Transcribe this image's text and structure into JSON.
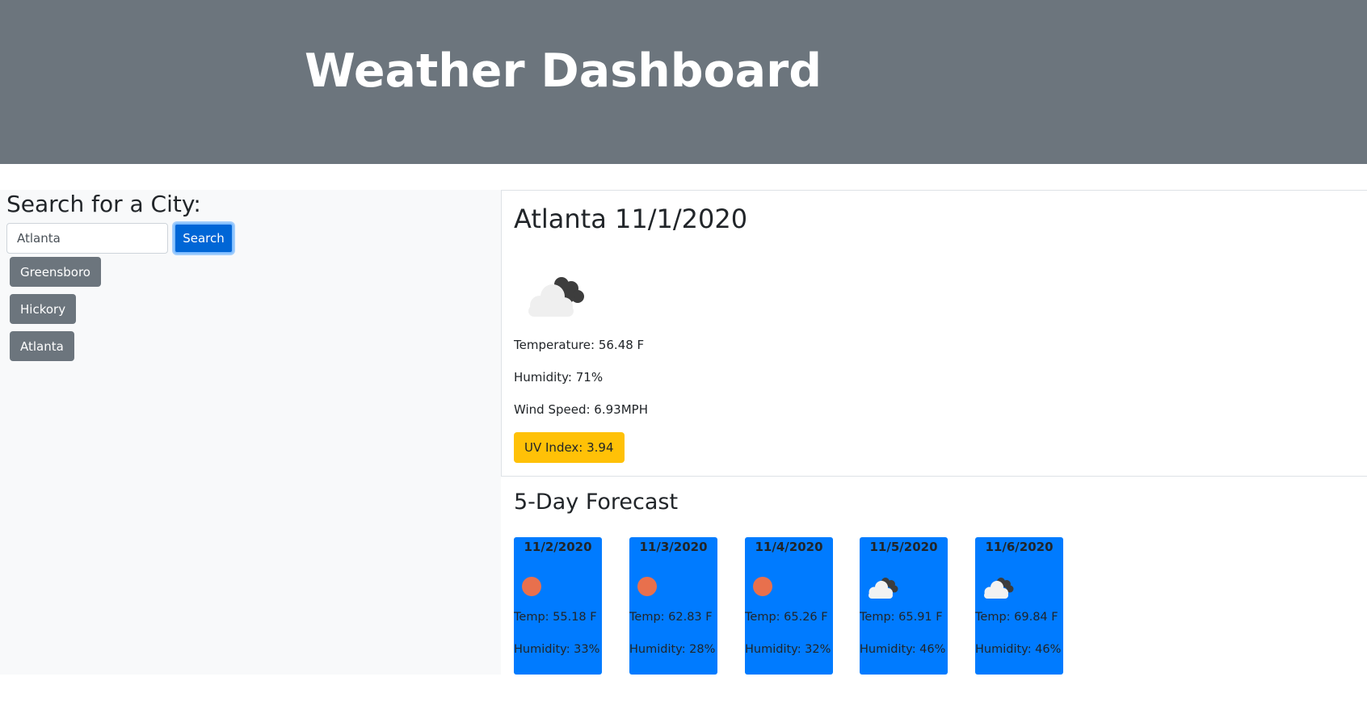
{
  "header": {
    "title": "Weather Dashboard"
  },
  "sidebar": {
    "heading": "Search for a City:",
    "search_value": "Atlanta",
    "search_button": "Search",
    "history": [
      "Greensboro",
      "Hickory",
      "Atlanta"
    ]
  },
  "current": {
    "title": "Atlanta 11/1/2020",
    "icon": "broken-clouds-icon",
    "temperature": "Temperature: 56.48 F",
    "humidity": "Humidity: 71%",
    "wind": "Wind Speed: 6.93MPH",
    "uv": "UV Index: 3.94",
    "uv_color": "#ffc107"
  },
  "forecast": {
    "title": "5-Day Forecast",
    "card_color": "#007bff",
    "days": [
      {
        "date": "11/2/2020",
        "icon": "sun-icon",
        "temp": "Temp: 55.18 F",
        "humidity": "Humidity: 33%"
      },
      {
        "date": "11/3/2020",
        "icon": "sun-icon",
        "temp": "Temp: 62.83 F",
        "humidity": "Humidity: 28%"
      },
      {
        "date": "11/4/2020",
        "icon": "sun-icon",
        "temp": "Temp: 65.26 F",
        "humidity": "Humidity: 32%"
      },
      {
        "date": "11/5/2020",
        "icon": "broken-clouds-icon",
        "temp": "Temp: 65.91 F",
        "humidity": "Humidity: 46%"
      },
      {
        "date": "11/6/2020",
        "icon": "broken-clouds-icon",
        "temp": "Temp: 69.84 F",
        "humidity": "Humidity: 46%"
      }
    ]
  }
}
